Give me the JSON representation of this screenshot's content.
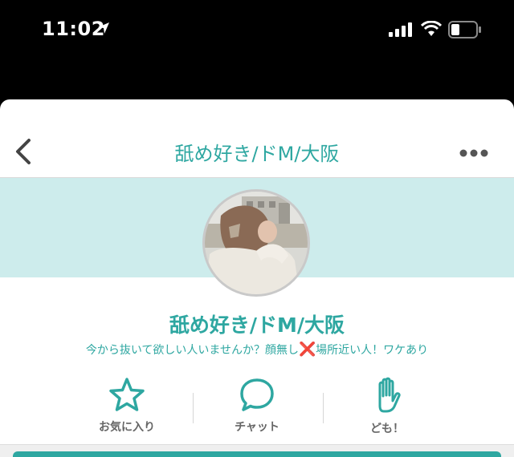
{
  "status": {
    "time": "11:02"
  },
  "nav": {
    "title": "舐め好き/ドM/大阪"
  },
  "profile": {
    "name": "舐め好き/ドM/大阪",
    "bio_before": "今から抜いて欲しい人いませんか？顔無し",
    "bio_mark": "❌",
    "bio_after": "場所近い人！ワケあり"
  },
  "actions": {
    "favorite": {
      "label": "お気に入り",
      "icon": "star-icon"
    },
    "chat": {
      "label": "チャット",
      "icon": "chat-bubble-icon"
    },
    "like": {
      "label": "ども！",
      "icon": "hand-icon"
    }
  },
  "colors": {
    "accent": "#2ea7a1",
    "banner": "#cdecec",
    "mark": "#e0102a"
  }
}
